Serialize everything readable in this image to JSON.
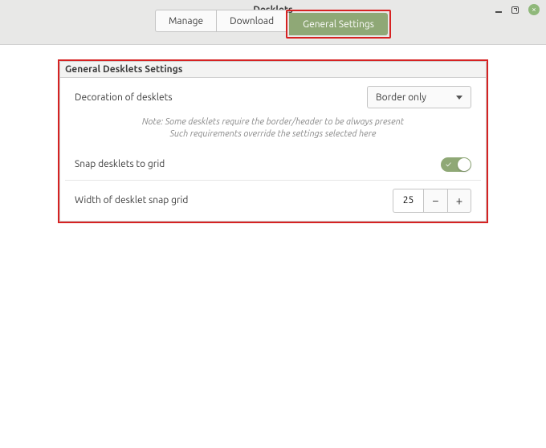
{
  "window": {
    "title": "Desklets"
  },
  "tabs": {
    "manage": "Manage",
    "download": "Download",
    "general_settings": "General Settings"
  },
  "panel": {
    "title": "General Desklets Settings",
    "decoration": {
      "label": "Decoration of desklets",
      "selected": "Border only"
    },
    "note_line1": "Note: Some desklets require the border/header to be always present",
    "note_line2": "Such requirements override the settings selected here",
    "snap": {
      "label": "Snap desklets to grid",
      "on": true
    },
    "grid_width": {
      "label": "Width of desklet snap grid",
      "value": "25",
      "minus": "−",
      "plus": "+"
    }
  }
}
